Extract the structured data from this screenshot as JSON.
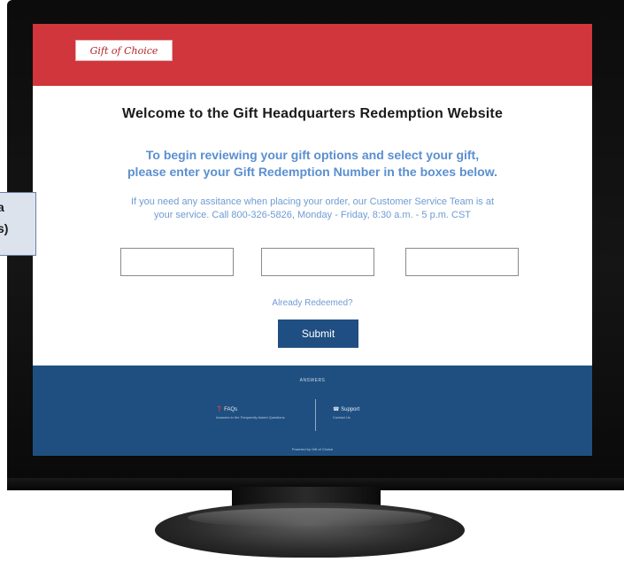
{
  "logo": {
    "text": "Gift of Choice"
  },
  "page": {
    "welcome": "Welcome to the Gift Headquarters Redemption Website",
    "subtitle_line1": "To begin reviewing your gift options and select your gift,",
    "subtitle_line2": "please enter your Gift Redemption Number in the boxes below.",
    "help_line1": "If you need any assitance when placing your order, our Customer Service Team is at",
    "help_line2": "your service. Call 800-326-5826, Monday - Friday, 8:30 a.m. - 5 p.m. CST",
    "already_link": "Already Redeemed?",
    "submit_label": "Submit"
  },
  "footer": {
    "heading": "ANSWERS",
    "col1_title": "FAQs",
    "col1_text": "Answers to the Frequently Asked Questions",
    "col2_title": "Support",
    "col2_text": "Contact Us",
    "powered": "Powered by Gift of Choice"
  },
  "callout": {
    "line1": "a",
    "line2": "s)"
  },
  "colors": {
    "header_red": "#d0363b",
    "heading_blue": "#5a8fd0",
    "button_navy": "#1f4f82",
    "footer_navy": "#1f4f80"
  }
}
